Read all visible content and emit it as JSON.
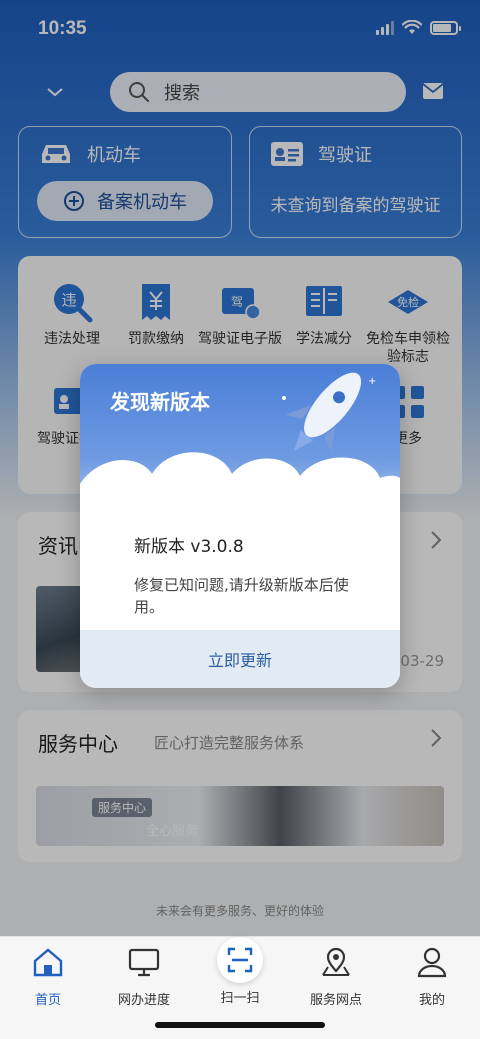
{
  "status_bar": {
    "time": "10:35"
  },
  "search": {
    "placeholder": "搜索"
  },
  "quick_cards": {
    "vehicle": {
      "title": "机动车",
      "button": "备案机动车"
    },
    "license": {
      "title": "驾驶证",
      "message": "未查询到备案的驾驶证"
    }
  },
  "services": {
    "row1": [
      {
        "label": "违法处理",
        "icon": "violation-icon",
        "glyph": "违"
      },
      {
        "label": "罚款缴纳",
        "icon": "fine-payment-icon"
      },
      {
        "label": "驾驶证电子版",
        "icon": "e-license-icon",
        "glyph": "驾"
      },
      {
        "label": "学法减分",
        "icon": "study-book-icon"
      },
      {
        "label": "免检车申领检验标志",
        "icon": "inspection-exempt-icon",
        "glyph": "免检"
      }
    ],
    "row2": [
      {
        "label": "驾驶证换领",
        "icon": "license-renewal-icon"
      },
      {
        "label": "更多",
        "icon": "more-grid-icon"
      }
    ]
  },
  "news": {
    "title": "资讯中心",
    "date": "03-29"
  },
  "service_center": {
    "title": "服务中心",
    "subtitle": "匠心打造完整服务体系",
    "banner_tag": "服务中心",
    "banner_text": "全心服务"
  },
  "footer": {
    "line1": "未来会有更多服务、更好的体验"
  },
  "bottom_nav": [
    {
      "label": "首页",
      "icon": "home-icon",
      "active": true
    },
    {
      "label": "网办进度",
      "icon": "monitor-icon"
    },
    {
      "label": "扫一扫",
      "icon": "scan-icon"
    },
    {
      "label": "服务网点",
      "icon": "map-pin-icon"
    },
    {
      "label": "我的",
      "icon": "user-icon"
    }
  ],
  "modal": {
    "title": "发现新版本",
    "version": "新版本 v3.0.8",
    "description": "修复已知问题,请升级新版本后使用。",
    "button": "立即更新"
  },
  "colors": {
    "brand": "#1f5fbf",
    "modal_button": "#2c5e9f"
  }
}
